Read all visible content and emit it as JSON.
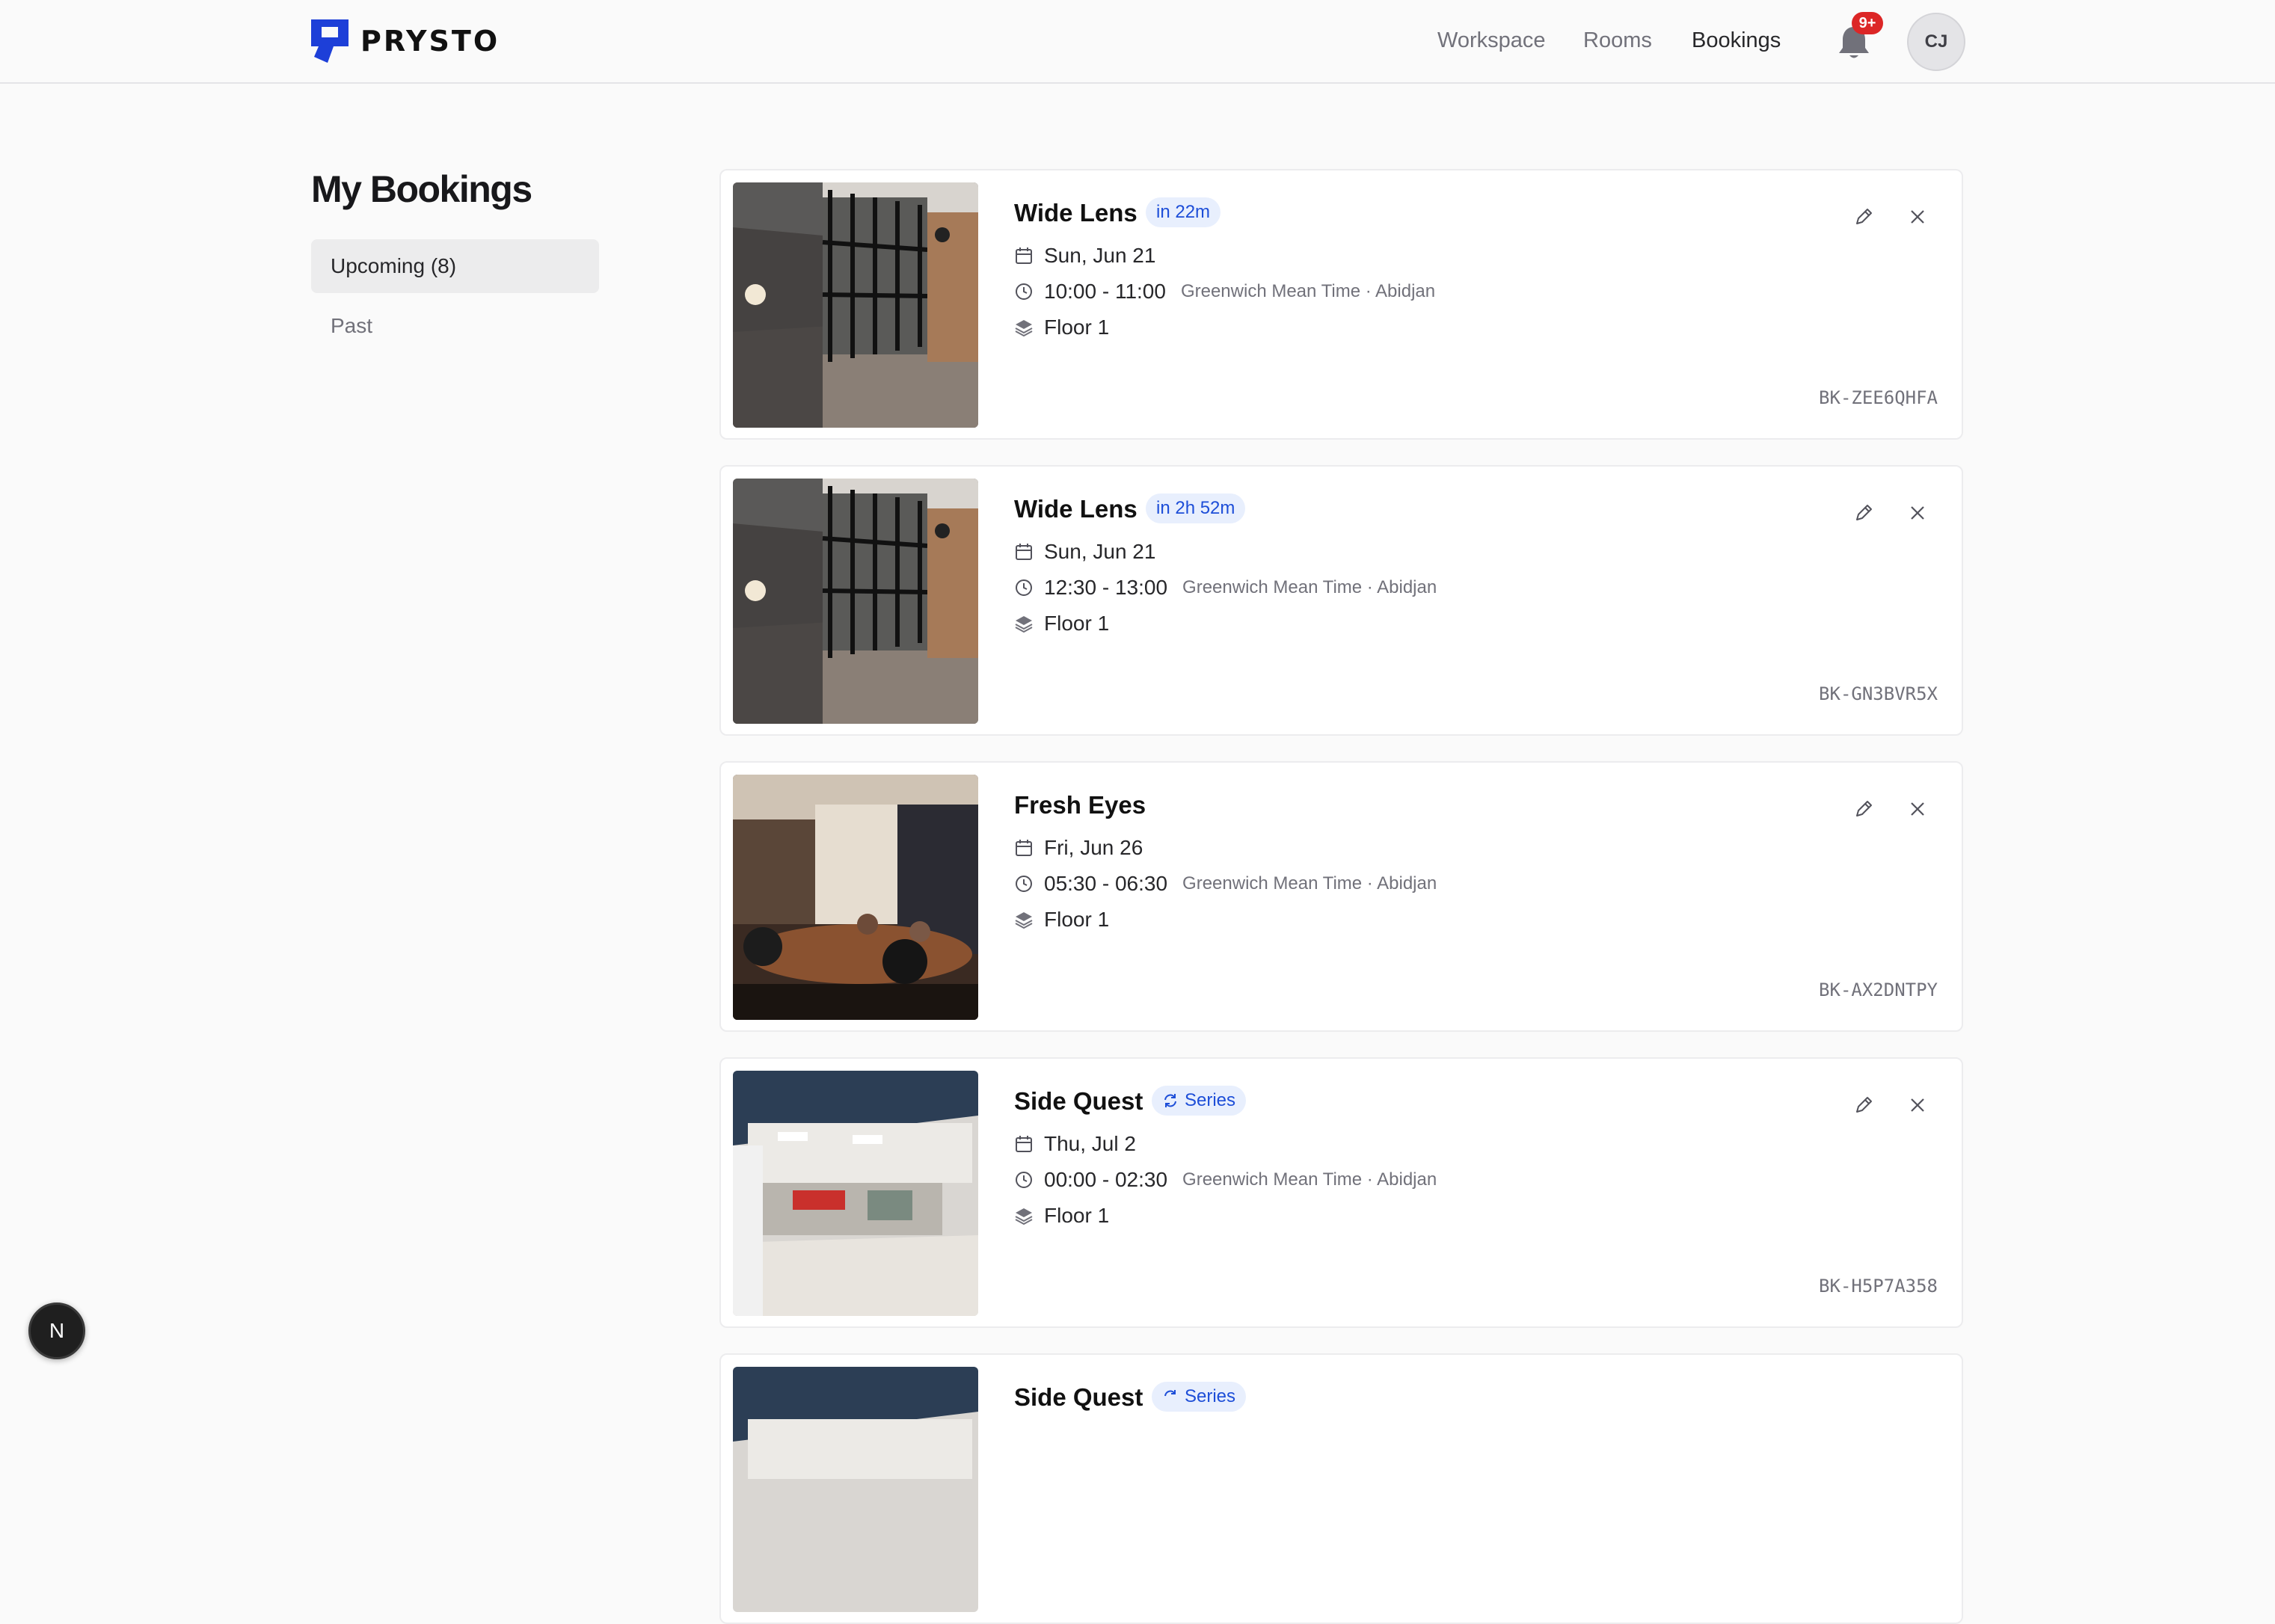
{
  "brand": {
    "name": "PRYSTO",
    "accent": "#1d3fd8"
  },
  "nav": {
    "workspace": "Workspace",
    "rooms": "Rooms",
    "bookings": "Bookings",
    "notification_count": "9+",
    "avatar_initials": "CJ"
  },
  "page": {
    "title": "My Bookings"
  },
  "tabs": {
    "upcoming": "Upcoming (8)",
    "past": "Past"
  },
  "bookings": [
    {
      "room": "Wide Lens",
      "badge": "in 22m",
      "date": "Sun, Jun 21",
      "time": "10:00 - 11:00",
      "timezone": "Greenwich Mean Time · Abidjan",
      "floor": "Floor 1",
      "ref": "BK-ZEE6QHFA"
    },
    {
      "room": "Wide Lens",
      "badge": "in 2h 52m",
      "date": "Sun, Jun 21",
      "time": "12:30 - 13:00",
      "timezone": "Greenwich Mean Time · Abidjan",
      "floor": "Floor 1",
      "ref": "BK-GN3BVR5X"
    },
    {
      "room": "Fresh Eyes",
      "date": "Fri, Jun 26",
      "time": "05:30 - 06:30",
      "timezone": "Greenwich Mean Time · Abidjan",
      "floor": "Floor 1",
      "ref": "BK-AX2DNTPY"
    },
    {
      "room": "Side Quest",
      "badge": "Series",
      "date": "Thu, Jul 2",
      "time": "00:00 - 02:30",
      "timezone": "Greenwich Mean Time · Abidjan",
      "floor": "Floor 1",
      "ref": "BK-H5P7A358"
    },
    {
      "room": "Side Quest",
      "badge": "Series"
    }
  ],
  "fab": {
    "label": "N"
  }
}
